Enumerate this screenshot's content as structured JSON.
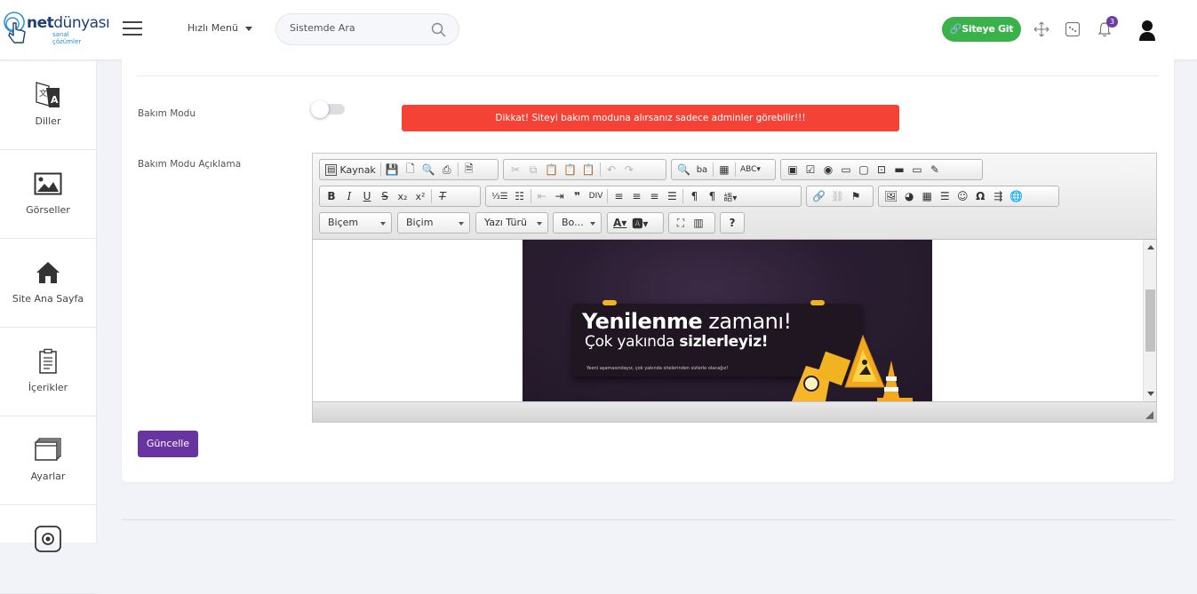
{
  "header": {
    "logo_main": "net",
    "logo_second": "dünyası",
    "logo_sub": "sanal çözümler",
    "quick_menu": "Hızlı Menü",
    "search_placeholder": "Sistemde Ara",
    "visit_site": "Siteye Git",
    "notification_count": "3"
  },
  "sidebar": {
    "items": [
      {
        "label": "Diller",
        "icon": "translate-icon"
      },
      {
        "label": "Görseller",
        "icon": "image-icon"
      },
      {
        "label": "Site Ana Sayfa",
        "icon": "home-icon"
      },
      {
        "label": "İçerikler",
        "icon": "clipboard-icon"
      },
      {
        "label": "Ayarlar",
        "icon": "windows-icon"
      },
      {
        "label": "",
        "icon": "camera-icon"
      }
    ]
  },
  "form": {
    "maintenance_label": "Bakım Modu",
    "maintenance_enabled": false,
    "alert_text": "Dikkat! Siteyi bakım moduna alırsanız sadece adminler görebilir!!!",
    "description_label": "Bakım Modu Açıklama",
    "update_button": "Güncelle"
  },
  "editor": {
    "source_label": "Kaynak",
    "styles_combo": "Biçem",
    "format_combo": "Biçim",
    "font_combo": "Yazı Türü",
    "size_combo": "Bo...",
    "help_label": "?"
  },
  "banner": {
    "title_bold": "Yenilenme",
    "title_light": " zamanı!",
    "subtitle_light": "Çok yakında ",
    "subtitle_bold": "sizlerleyiz!",
    "small_text": "Yeeni aşamasındayız, çok yakında sitelerinden sizlerle olacağız!"
  },
  "colors": {
    "accent": "#6a33a2",
    "success": "#3ab24a",
    "danger": "#f44336"
  }
}
